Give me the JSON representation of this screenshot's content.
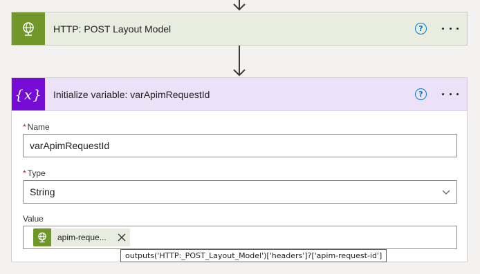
{
  "http_card": {
    "title": "HTTP: POST Layout Model",
    "icon": "globe-icon",
    "help": "?",
    "accent": "#709727"
  },
  "variable_card": {
    "title": "Initialize variable: varApimRequestId",
    "icon": "variable-icon",
    "icon_glyph": "{x}",
    "help": "?",
    "accent": "#770bd6",
    "name_field": {
      "label": "Name",
      "required": "*",
      "value": "varApimRequestId"
    },
    "type_field": {
      "label": "Type",
      "required": "*",
      "value": "String"
    },
    "value_field": {
      "label": "Value",
      "token": {
        "label": "apim-reque...",
        "icon": "globe-icon"
      }
    }
  },
  "tooltip": {
    "text": "outputs('HTTP:_POST_Layout_Model')['headers']?['apim-request-id']"
  }
}
